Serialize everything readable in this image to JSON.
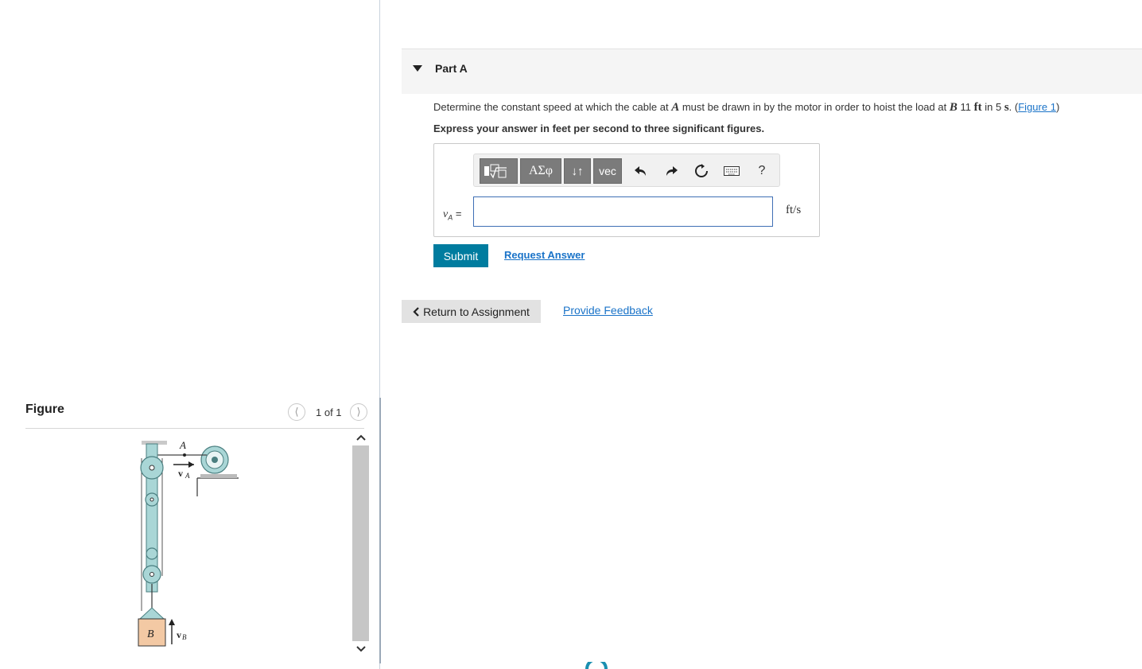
{
  "figure_panel": {
    "title": "Figure",
    "pager": {
      "label": "1 of 1"
    },
    "diagram_labels": {
      "point_a": "A",
      "velocity_a": "v",
      "velocity_a_sub": "A",
      "block_b": "B",
      "velocity_b": "v",
      "velocity_b_sub": "B"
    }
  },
  "part": {
    "title": "Part A",
    "question": {
      "intro": "Determine the constant speed at which the cable at ",
      "point_a": "A",
      "middle": " must be drawn in by the motor in order to hoist the load at ",
      "point_b": "B",
      "distance_value": "11",
      "distance_unit": "ft",
      "in_word": "in",
      "time_value": "5",
      "time_unit": "s",
      "figure_link": "Figure 1"
    },
    "instruction": "Express your answer in feet per second to three significant figures."
  },
  "answer": {
    "toolbar": {
      "greek_label": "ΑΣφ",
      "updown_label": "↓↑",
      "vec_label": "vec",
      "help_label": "?"
    },
    "variable": "v",
    "variable_sub": "A",
    "equals": "=",
    "input_value": "",
    "units": "ft/s"
  },
  "actions": {
    "submit_label": "Submit",
    "request_answer_label": "Request Answer",
    "return_label": "Return to Assignment",
    "feedback_label": "Provide Feedback"
  }
}
